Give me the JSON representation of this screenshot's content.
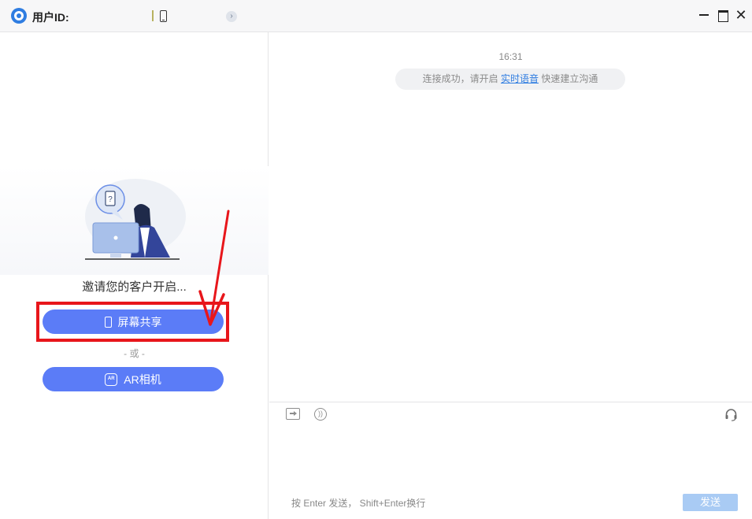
{
  "titlebar": {
    "user_id_label": "用户ID:",
    "logo_icon": "app-logo-icon",
    "device_icon": "phone-icon",
    "info_icon": "arrow-circle-icon",
    "window_controls": [
      "minimize-icon",
      "maximize-icon",
      "close-icon"
    ],
    "close_glyph": "✕",
    "info_glyph": "›"
  },
  "left_panel": {
    "invite_text": "邀请您的客户开启...",
    "share_button_label": "屏幕共享",
    "or_text": "- 或 -",
    "ar_button_label": "AR相机",
    "ar_icon_text": "AR",
    "illustration_bubble_text": "?",
    "highlight_color": "#e8161b",
    "button_color": "#5b7cf7"
  },
  "chat": {
    "timestamp": "16:31",
    "system_message_prefix": "连接成功，请开启",
    "system_message_link": "实时语音",
    "system_message_suffix": "快速建立沟通"
  },
  "input": {
    "toolbar_icons": [
      "file-transfer-icon",
      "voice-icon",
      "headset-icon"
    ],
    "voice_glyph": "))",
    "hint": "按 Enter 发送， Shift+Enter换行",
    "send_label": "发送",
    "send_color": "#a9cbf4"
  }
}
